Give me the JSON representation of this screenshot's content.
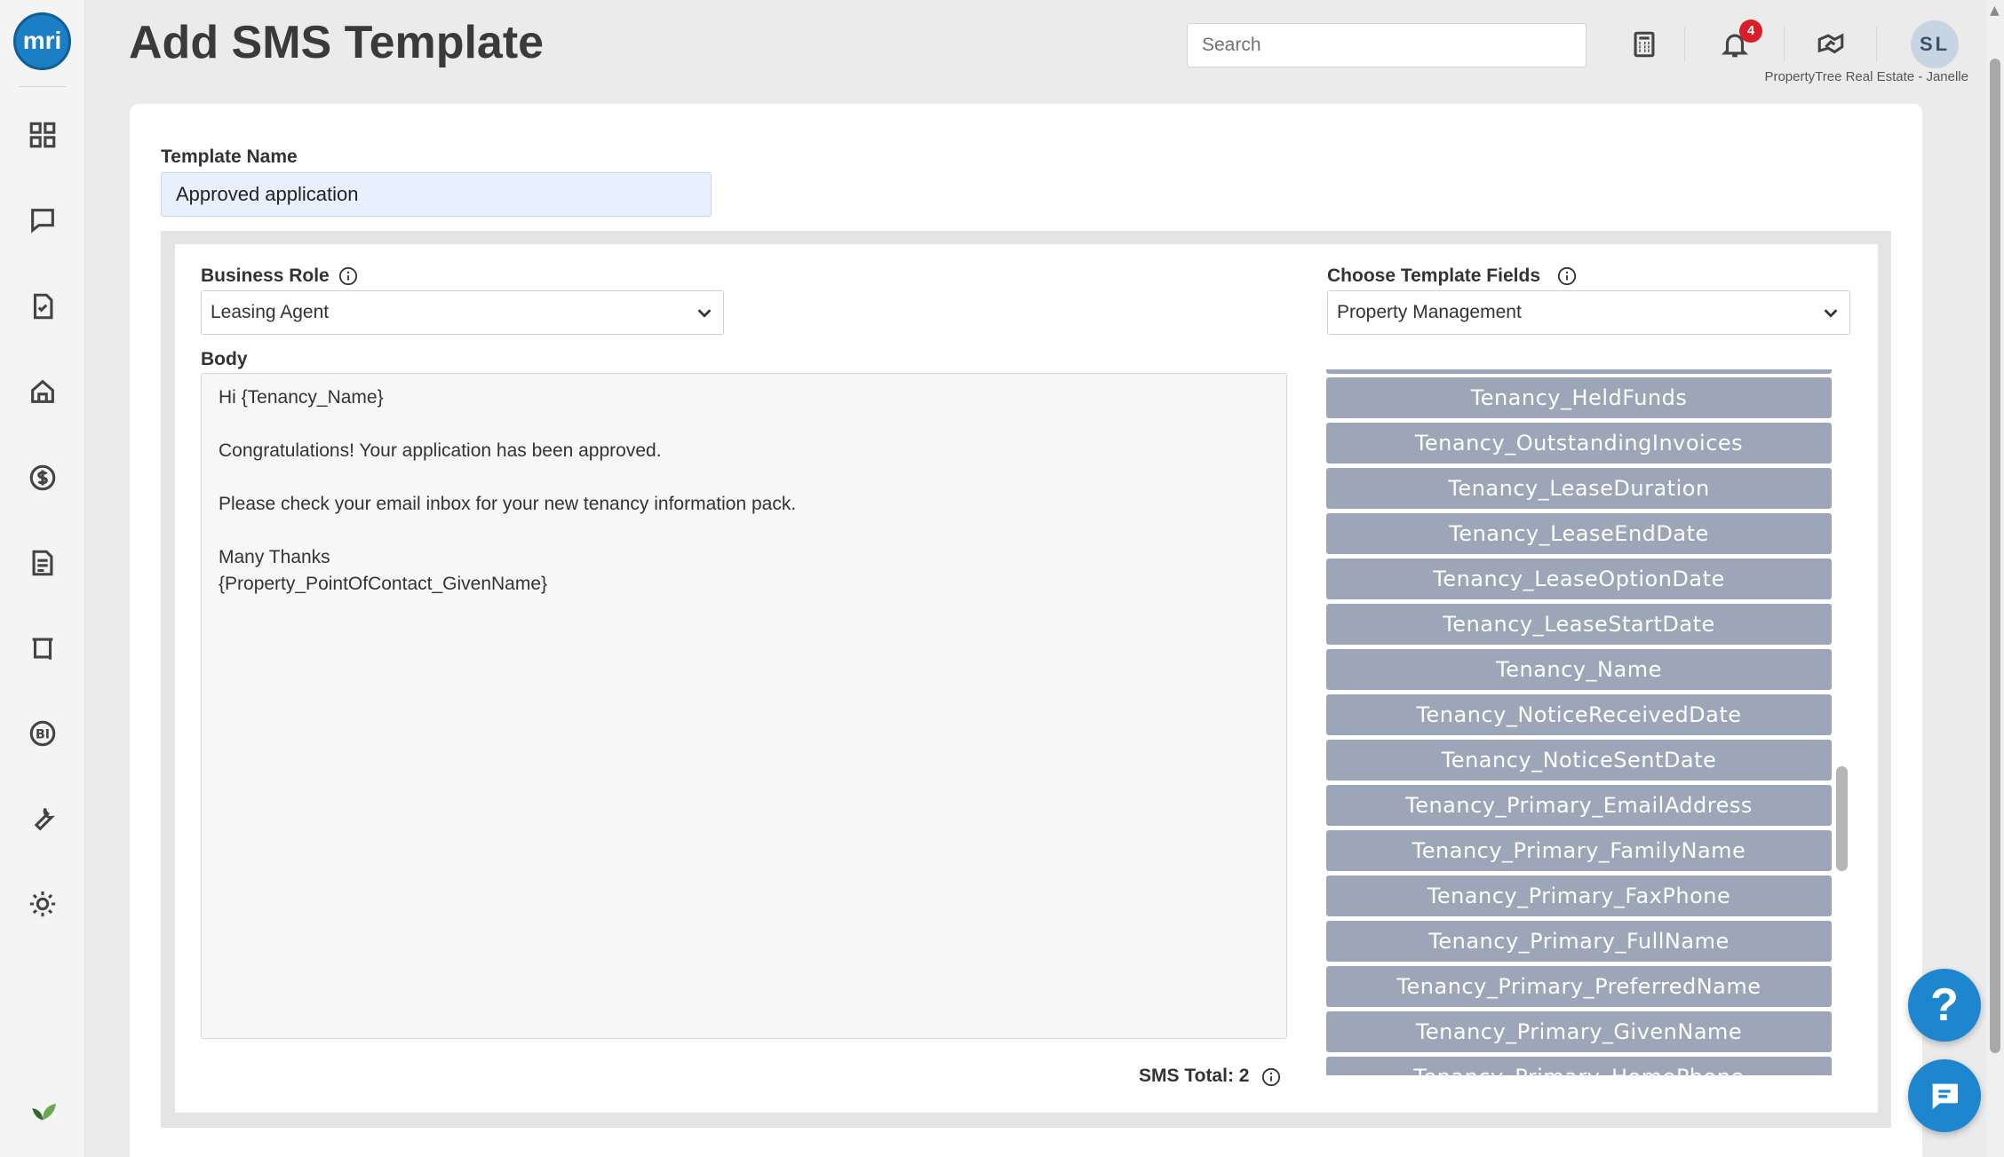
{
  "app": {
    "logo_text": "mri",
    "page_title": "Add SMS Template"
  },
  "header": {
    "search_placeholder": "Search",
    "notification_count": "4",
    "user_initials": "SL",
    "user_caption": "PropertyTree Real Estate - Janelle",
    "icons": [
      "calculator-icon",
      "bell-icon",
      "handshake-icon"
    ]
  },
  "sidebar": {
    "items": [
      {
        "name": "dashboard-icon"
      },
      {
        "name": "chat-icon"
      },
      {
        "name": "tasks-icon"
      },
      {
        "name": "property-icon"
      },
      {
        "name": "money-icon"
      },
      {
        "name": "documents-icon"
      },
      {
        "name": "listings-icon"
      },
      {
        "name": "bi-icon"
      },
      {
        "name": "tools-icon"
      },
      {
        "name": "settings-icon"
      }
    ]
  },
  "form": {
    "template_name_label": "Template Name",
    "template_name_value": "Approved application",
    "business_role_label": "Business Role",
    "business_role_value": "Leasing Agent",
    "template_fields_label": "Choose Template Fields",
    "template_fields_value": "Property Management",
    "body_label": "Body",
    "body_text": "Hi {Tenancy_Name}\n\nCongratulations! Your application has been approved.\n\nPlease check your email inbox for your new tenancy information pack.\n\nMany Thanks\n{Property_PointOfContact_GivenName}",
    "sms_total": "SMS Total: 2"
  },
  "fields": [
    "Tenancy_HeldFunds",
    "Tenancy_OutstandingInvoices",
    "Tenancy_LeaseDuration",
    "Tenancy_LeaseEndDate",
    "Tenancy_LeaseOptionDate",
    "Tenancy_LeaseStartDate",
    "Tenancy_Name",
    "Tenancy_NoticeReceivedDate",
    "Tenancy_NoticeSentDate",
    "Tenancy_Primary_EmailAddress",
    "Tenancy_Primary_FamilyName",
    "Tenancy_Primary_FaxPhone",
    "Tenancy_Primary_FullName",
    "Tenancy_Primary_PreferredName",
    "Tenancy_Primary_GivenName",
    "Tenancy_Primary_HomePhone"
  ],
  "fab": {
    "help_label": "?"
  },
  "colors": {
    "accent": "#1e86cf",
    "field_button": "#9ca6b8",
    "badge": "#d91e2a"
  }
}
